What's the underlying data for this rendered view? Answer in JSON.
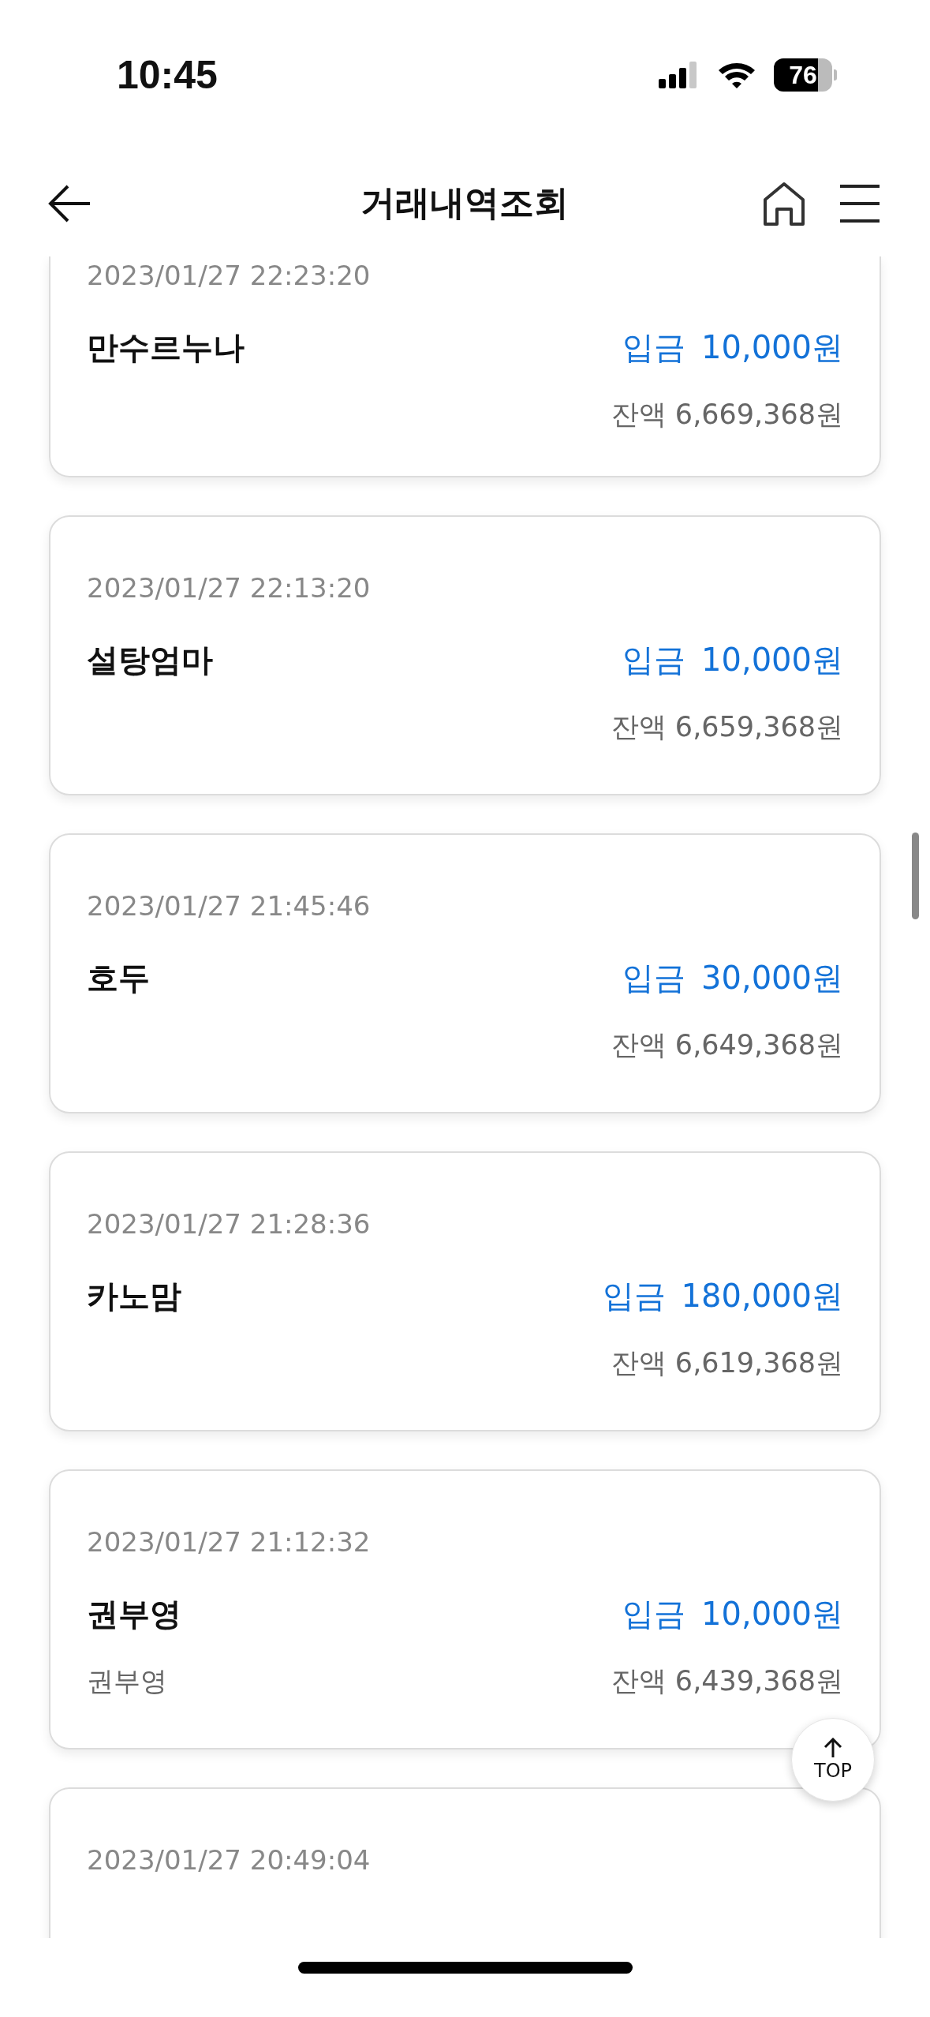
{
  "status_bar": {
    "time": "10:45",
    "battery": "76"
  },
  "header": {
    "title": "거래내역조회"
  },
  "transactions": [
    {
      "datetime": "2023/01/27 22:23:20",
      "name": "만수르누나",
      "type": "입금",
      "amount": "10,000원",
      "balance": "잔액 6,669,368원"
    },
    {
      "datetime": "2023/01/27 22:13:20",
      "name": "설탕엄마",
      "type": "입금",
      "amount": "10,000원",
      "balance": "잔액 6,659,368원"
    },
    {
      "datetime": "2023/01/27 21:45:46",
      "name": "호두",
      "type": "입금",
      "amount": "30,000원",
      "balance": "잔액 6,649,368원"
    },
    {
      "datetime": "2023/01/27 21:28:36",
      "name": "카노맘",
      "type": "입금",
      "amount": "180,000원",
      "balance": "잔액 6,619,368원"
    },
    {
      "datetime": "2023/01/27 21:12:32",
      "name": "권부영",
      "memo": "권부영",
      "type": "입금",
      "amount": "10,000원",
      "balance": "잔액 6,439,368원"
    },
    {
      "datetime": "2023/01/27 20:49:04"
    }
  ],
  "top_button": {
    "label": "TOP"
  }
}
